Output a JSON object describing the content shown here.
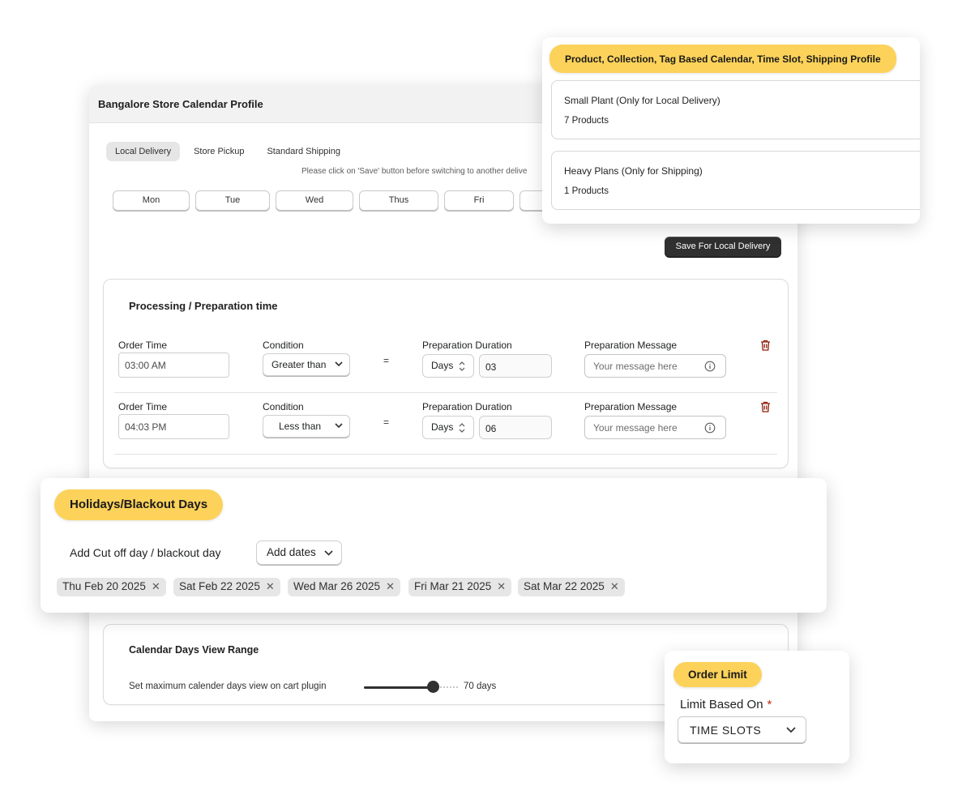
{
  "profile": {
    "title": "Bangalore Store Calendar Profile",
    "tabs": [
      "Local Delivery",
      "Store Pickup",
      "Standard Shipping"
    ],
    "active_tab": "Local Delivery",
    "notice": "Please click on 'Save' button before switching to another delive",
    "days": [
      "Mon",
      "Tue",
      "Wed",
      "Thus",
      "Fri",
      ""
    ],
    "save_label": "Save For Local Delivery"
  },
  "processing": {
    "title": "Processing / Preparation time",
    "labels": {
      "order_time": "Order Time",
      "condition": "Condition",
      "duration": "Preparation Duration",
      "message": "Preparation Message",
      "equals": "="
    },
    "rows": [
      {
        "order_time": "03:00 AM",
        "condition": "Greater than",
        "unit": "Days",
        "duration": "03",
        "message_placeholder": "Your message here"
      },
      {
        "order_time": "04:03 PM",
        "condition": "Less than",
        "unit": "Days",
        "duration": "06",
        "message_placeholder": "Your message here"
      }
    ]
  },
  "calendar_range": {
    "title": "Calendar Days View Range",
    "description": "Set maximum calender days view on cart plugin",
    "value": 70,
    "value_label": "70 days"
  },
  "products_card": {
    "pill": "Product, Collection, Tag Based Calendar, Time Slot, Shipping Profile",
    "items": [
      {
        "name": "Small Plant (Only for Local Delivery)",
        "count": "7 Products"
      },
      {
        "name": "Heavy Plans (Only for Shipping)",
        "count": "1 Products"
      }
    ]
  },
  "holidays": {
    "pill": "Holidays/Blackout Days",
    "cutoff_label": "Add Cut off day / blackout day",
    "add_dates_label": "Add dates",
    "dates": [
      "Thu Feb 20 2025",
      "Sat Feb 22 2025",
      "Wed Mar 26 2025",
      "Fri Mar 21 2025",
      "Sat Mar 22 2025"
    ],
    "remove_glyph": "✕"
  },
  "order_limit": {
    "pill": "Order Limit",
    "label": "Limit Based On",
    "required": "*",
    "selected": "TIME SLOTS"
  },
  "colors": {
    "accent_pill": "#fcd25a",
    "primary_button": "#303030",
    "trash_icon": "#8e1f0b"
  }
}
